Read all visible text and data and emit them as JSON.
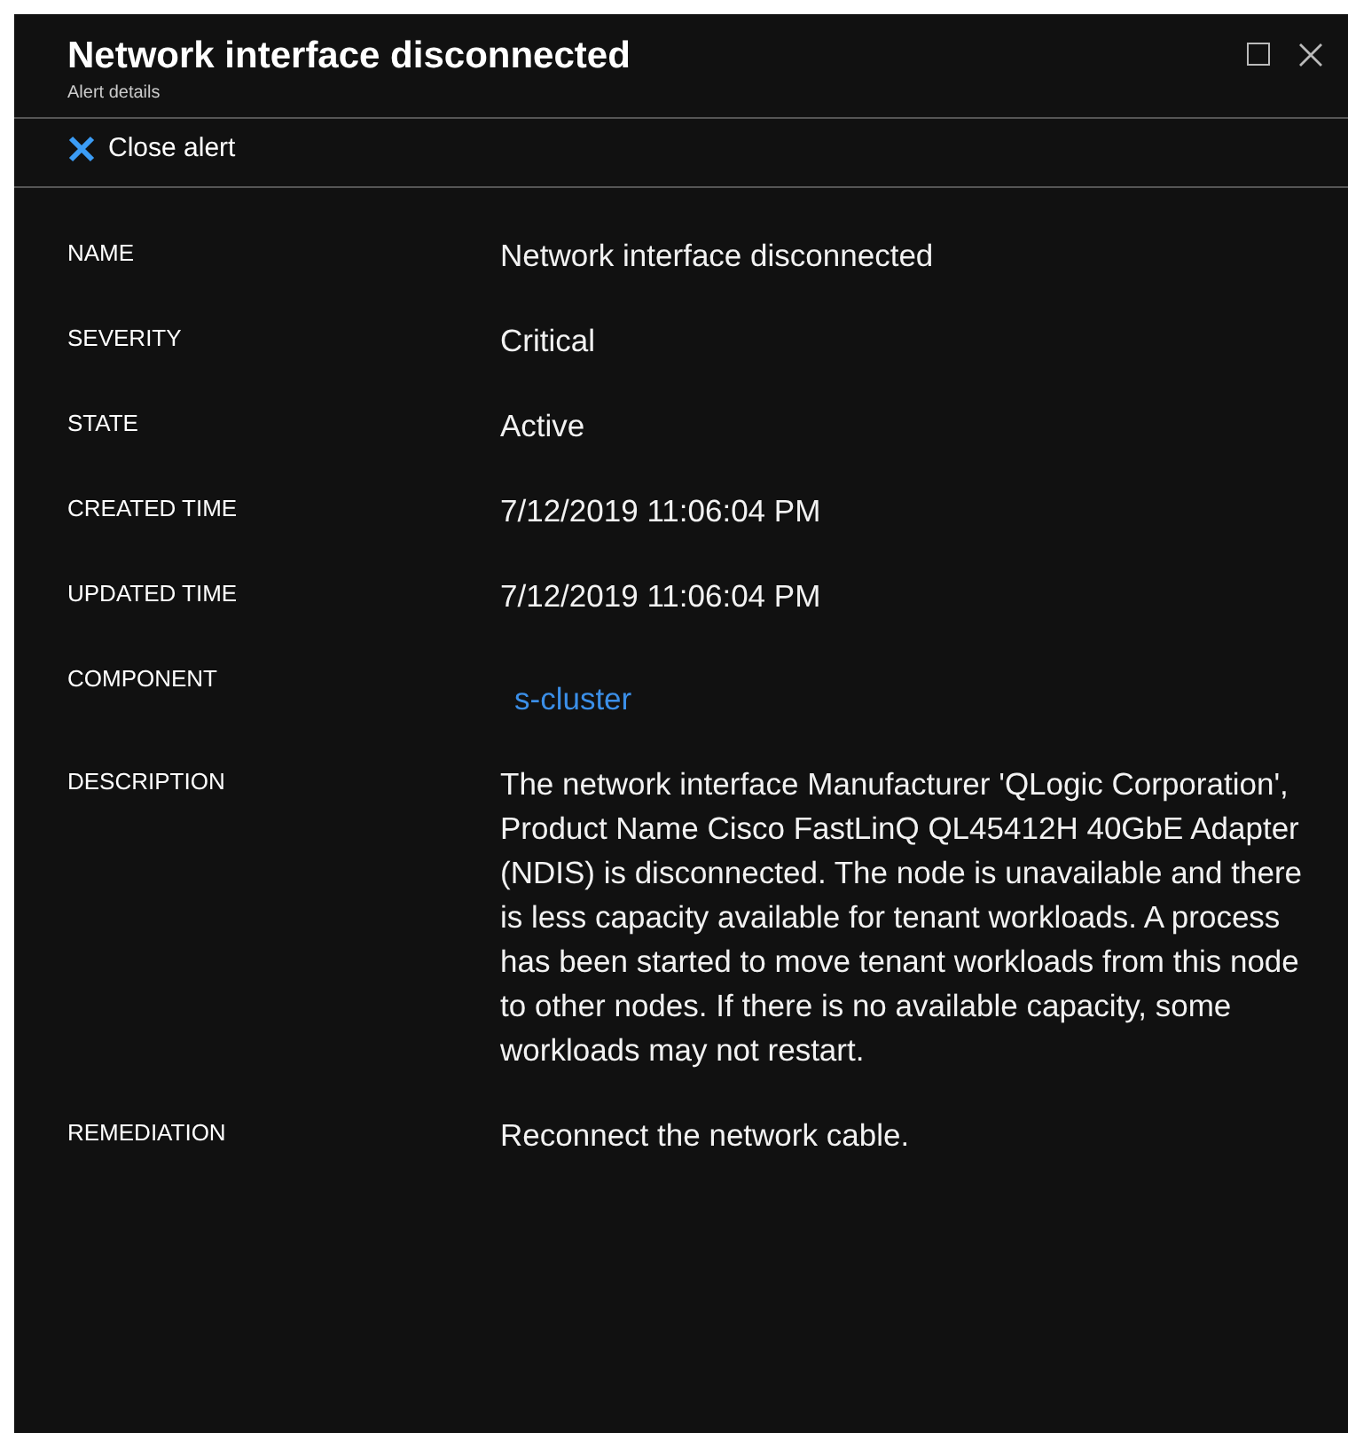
{
  "header": {
    "title": "Network interface disconnected",
    "subtitle": "Alert details"
  },
  "toolbar": {
    "close_alert": "Close alert"
  },
  "fields": [
    {
      "label": "NAME",
      "value": "Network interface disconnected",
      "kind": "text"
    },
    {
      "label": "SEVERITY",
      "value": "Critical",
      "kind": "text"
    },
    {
      "label": "STATE",
      "value": "Active",
      "kind": "text"
    },
    {
      "label": "CREATED TIME",
      "value": "7/12/2019 11:06:04 PM",
      "kind": "text"
    },
    {
      "label": "UPDATED TIME",
      "value": "7/12/2019 11:06:04 PM",
      "kind": "text"
    },
    {
      "label": "COMPONENT",
      "value": "s-cluster",
      "kind": "link"
    },
    {
      "label": "DESCRIPTION",
      "value": "The network interface Manufacturer 'QLogic Corporation', Product Name Cisco FastLinQ QL45412H 40GbE Adapter (NDIS) is disconnected. The node is unavailable and there is less capacity available for tenant workloads. A process has been started to move tenant workloads from this node to other nodes. If there is no available capacity, some workloads may not restart.",
      "kind": "text"
    },
    {
      "label": "REMEDIATION",
      "value": "Reconnect the network cable.",
      "kind": "text"
    }
  ]
}
